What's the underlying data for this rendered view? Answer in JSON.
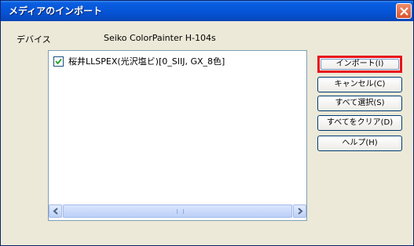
{
  "window": {
    "title": "メディアのインポート"
  },
  "device": {
    "label": "デバイス",
    "name": "Seiko ColorPainter H-104s"
  },
  "list": {
    "items": [
      {
        "label": "桜井LLSPEX(光沢塩ビ)[0_SIIJ, GX_8色]",
        "checked": true
      }
    ]
  },
  "buttons": {
    "import": "インポート(I)",
    "cancel": "キャンセル(C)",
    "select_all": "すべて選択(S)",
    "clear_all": "すべてをクリア(D)",
    "help": "ヘルプ(H)"
  },
  "colors": {
    "title_bar": "#0553d6",
    "highlight_box": "#e8121b",
    "dialog_bg": "#ece9d8"
  },
  "icons": {
    "close": "close-icon",
    "check": "check-icon",
    "left": "left-arrow-icon",
    "right": "right-arrow-icon"
  }
}
